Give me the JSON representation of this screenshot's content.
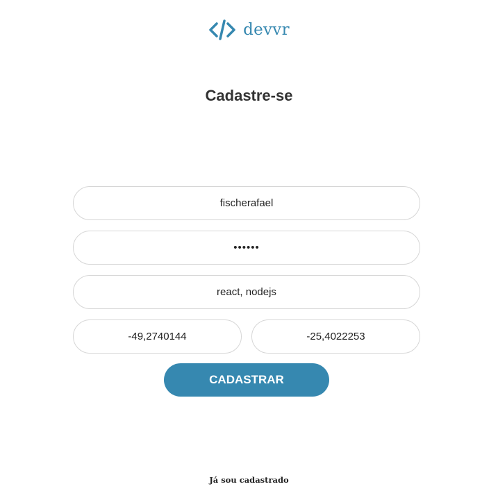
{
  "logo": {
    "text": "devvr",
    "icon": "code-brackets-icon",
    "color": "#3688b0"
  },
  "page_title": "Cadastre-se",
  "form": {
    "username_value": "fischerafael",
    "password_value": "••••••",
    "techs_value": "react, nodejs",
    "longitude_value": "-49,2740144",
    "latitude_value": "-25,4022253"
  },
  "submit_label": "CADASTRAR",
  "login_link": "Já sou cadastrado",
  "colors": {
    "accent": "#3688b0",
    "text": "#333333",
    "border": "#d6d6d6"
  }
}
